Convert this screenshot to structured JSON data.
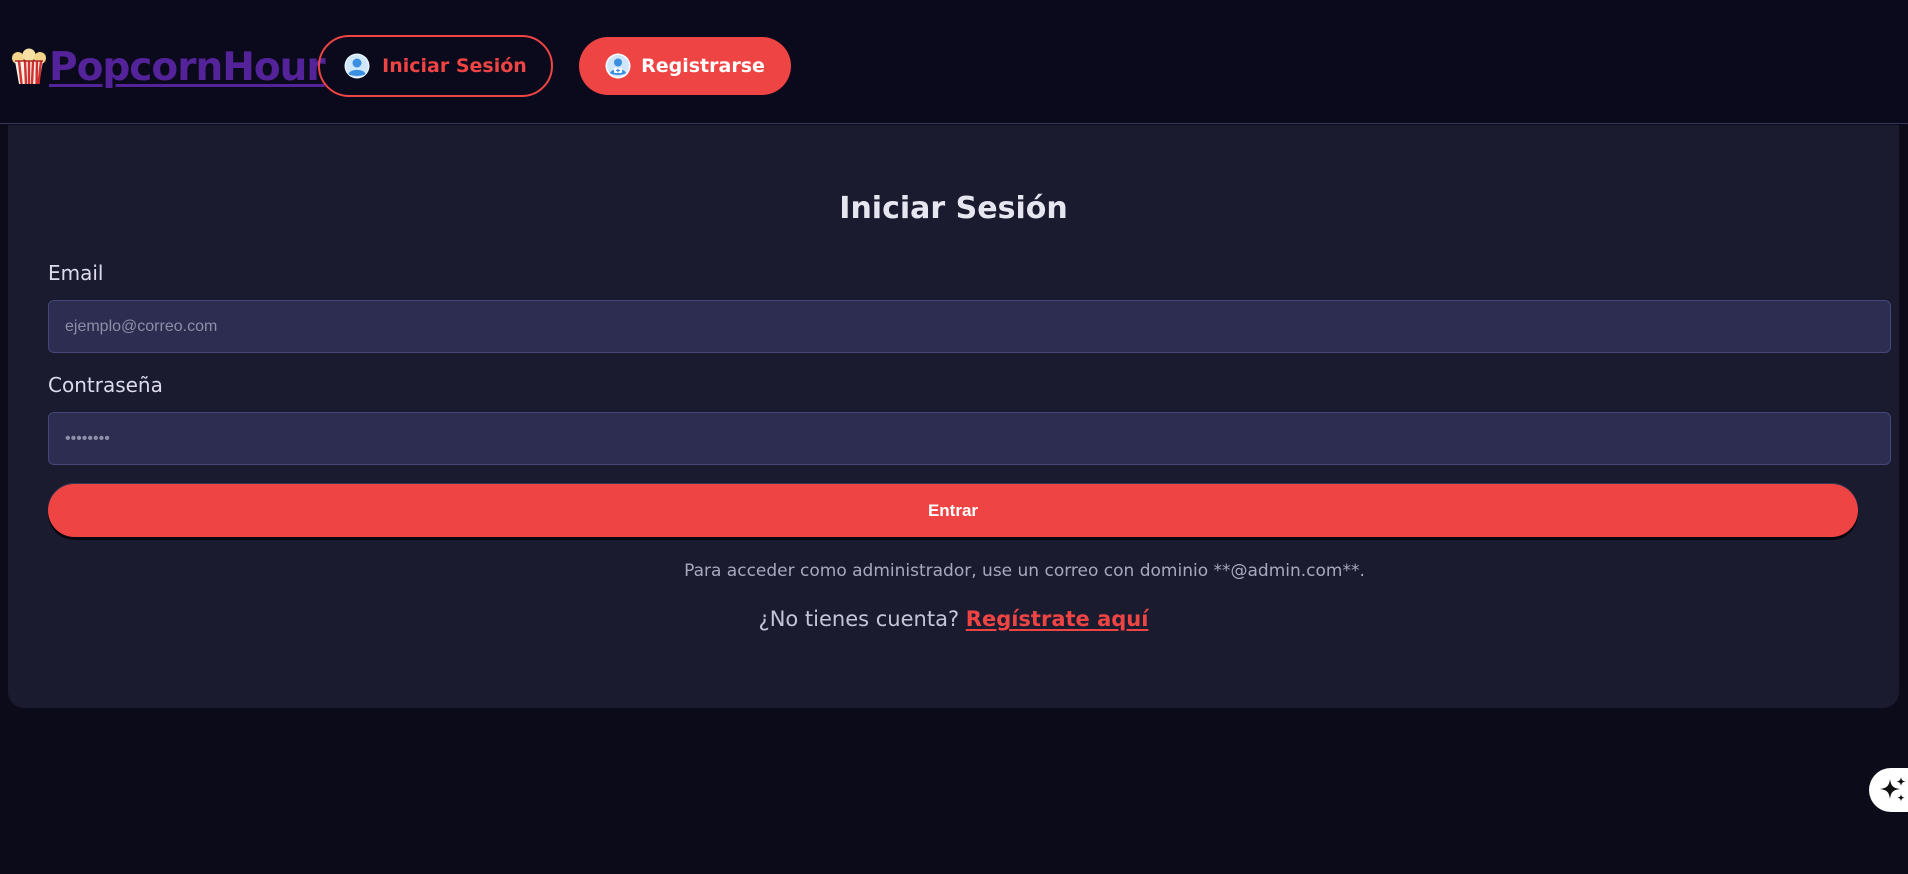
{
  "header": {
    "logo_text": "PopcornHour",
    "login_button": "Iniciar Sesión",
    "register_button": "Registrarse"
  },
  "form": {
    "title": "Iniciar Sesión",
    "email_label": "Email",
    "email_placeholder": "ejemplo@correo.com",
    "email_value": "",
    "password_label": "Contraseña",
    "password_placeholder": "••••••••",
    "password_value": "",
    "submit_button": "Entrar",
    "admin_note": "Para acceder como administrador, use un correo con dominio **@admin.com**.",
    "no_account_text": "¿No tienes cuenta?",
    "register_link": "Regístrate aquí"
  },
  "icons": {
    "logo": "popcorn-icon",
    "login": "user-icon",
    "register": "user-add-icon",
    "fab": "sparkle-icon"
  },
  "colors": {
    "accent": "#ef4444",
    "logo": "#54239a",
    "background": "#0b0b1a",
    "card": "#1b1b30",
    "input": "#2c2d50"
  }
}
